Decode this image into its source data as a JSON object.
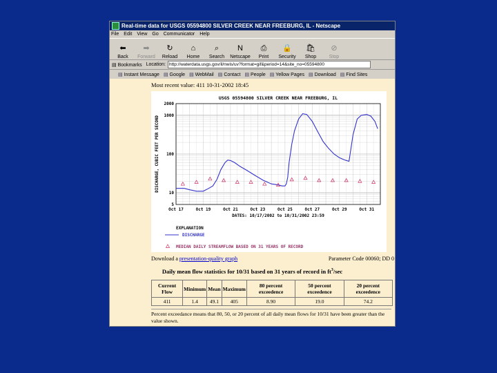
{
  "window": {
    "title": "Real-time data for USGS 05594800 SILVER CREEK NEAR FREEBURG, IL - Netscape"
  },
  "menu": [
    "File",
    "Edit",
    "View",
    "Go",
    "Communicator",
    "Help"
  ],
  "toolbar": [
    {
      "label": "Back",
      "icon": "back-arrow-icon",
      "glyph": "⬅",
      "enabled": true
    },
    {
      "label": "Forward",
      "icon": "forward-arrow-icon",
      "glyph": "➡",
      "enabled": false
    },
    {
      "label": "Reload",
      "icon": "reload-icon",
      "glyph": "↻",
      "enabled": true
    },
    {
      "label": "Home",
      "icon": "home-icon",
      "glyph": "⌂",
      "enabled": true
    },
    {
      "label": "Search",
      "icon": "search-icon",
      "glyph": "⌕",
      "enabled": true
    },
    {
      "label": "Netscape",
      "icon": "netscape-icon",
      "glyph": "N",
      "enabled": true
    },
    {
      "label": "Print",
      "icon": "print-icon",
      "glyph": "⎙",
      "enabled": true
    },
    {
      "label": "Security",
      "icon": "lock-icon",
      "glyph": "🔒",
      "enabled": true
    },
    {
      "label": "Shop",
      "icon": "shop-icon",
      "glyph": "🛍",
      "enabled": true
    },
    {
      "label": "Stop",
      "icon": "stop-icon",
      "glyph": "⊘",
      "enabled": false
    }
  ],
  "location": {
    "bookmarks": "Bookmarks",
    "label": "Location:",
    "url": "http://waterdata.usgs.gov/il/nwis/uv?format=gif&period=14&site_no=05594800"
  },
  "personal": [
    "Instant Message",
    "Google",
    "WebMail",
    "Contact",
    "People",
    "Yellow Pages",
    "Download",
    "Find Sites"
  ],
  "page": {
    "most_recent": "Most recent value: 411   10-31-2002  18:45",
    "download_prefix": "Download a ",
    "download_link": "presentation-quality graph",
    "param_code": "Parameter Code 00060; DD 0",
    "stats_title": "Daily mean flow statistics for 10/31 based on 31 years of record in ft",
    "stats_unit_sup": "3",
    "stats_unit_suffix": "/sec",
    "stats": {
      "headers": [
        "Current Flow",
        "Minimum",
        "Mean",
        "Maximum",
        "80 percent exceedence",
        "50 percent exceedence",
        "20 percent exceedence"
      ],
      "values": [
        "411",
        "1.4",
        "49.1",
        "405",
        "8.90",
        "19.0",
        "74.2"
      ]
    },
    "note": "Percent exceedance means that 80, 50, or 20 percent of all daily mean flows for 10/31 have been greater than the value shown."
  },
  "chart_data": {
    "type": "line",
    "title": "USGS 05594800 SILVER CREEK NEAR FREEBURG, IL",
    "ylabel": "DISCHARGE, CUBIC FEET PER SECOND",
    "xlabel": "DATES: 10/17/2002 to 10/31/2002 23:59",
    "y_scale": "log",
    "ylim": [
      5,
      2000
    ],
    "y_ticks": [
      "2000",
      "1000",
      "100",
      "10",
      "5"
    ],
    "x_ticks": [
      "Oct 17",
      "Oct 19",
      "Oct 21",
      "Oct 23",
      "Oct 25",
      "Oct 27",
      "Oct 29",
      "Oct 31"
    ],
    "x_range": [
      17,
      32
    ],
    "legend_title": "EXPLANATION",
    "series": [
      {
        "name": "DISCHARGE",
        "style": "line",
        "color": "#3333cc",
        "x": [
          17,
          17.6,
          18.0,
          18.5,
          19.0,
          19.4,
          19.7,
          20.0,
          20.3,
          20.6,
          20.8,
          21.0,
          21.3,
          21.7,
          22.2,
          22.8,
          23.4,
          24.0,
          24.5,
          24.8,
          25.0,
          25.1,
          25.2,
          25.3,
          25.5,
          25.7,
          26.0,
          26.3,
          26.6,
          27.0,
          27.4,
          27.8,
          28.2,
          28.6,
          29.0,
          29.4,
          29.7,
          30.0,
          30.3,
          30.6,
          31.0,
          31.3,
          31.6,
          31.8
        ],
        "y": [
          13,
          13,
          12,
          11,
          11,
          13,
          15,
          22,
          40,
          60,
          70,
          68,
          60,
          48,
          38,
          28,
          21,
          17,
          16,
          15,
          15,
          17,
          25,
          60,
          180,
          400,
          800,
          1100,
          1050,
          700,
          380,
          210,
          140,
          100,
          80,
          70,
          65,
          320,
          800,
          1000,
          1050,
          950,
          700,
          450
        ]
      },
      {
        "name": "MEDIAN DAILY STREAMFLOW BASED ON 31 YEARS OF RECORD",
        "style": "triangle",
        "color": "#cc3366",
        "x": [
          17.5,
          18.5,
          19.5,
          20.5,
          21.5,
          22.5,
          23.5,
          24.5,
          25.5,
          26.5,
          27.5,
          28.5,
          29.5,
          30.5,
          31.5
        ],
        "y": [
          17,
          19,
          23,
          21,
          19,
          19,
          17,
          16,
          22,
          24,
          21,
          21,
          21,
          20,
          19
        ]
      }
    ]
  }
}
